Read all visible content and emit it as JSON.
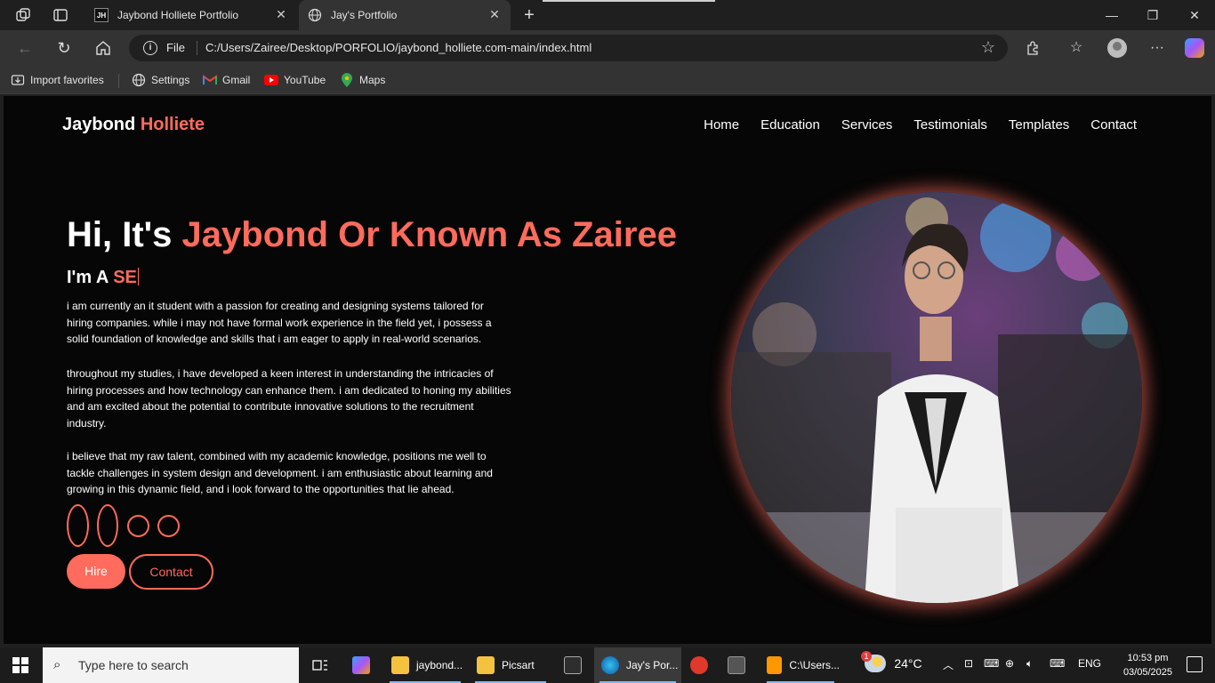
{
  "browser": {
    "tabs": [
      {
        "title": "Jaybond Holliete Portfolio",
        "favicon": "JH",
        "active": false
      },
      {
        "title": "Jay's Portfolio",
        "favicon": "globe-icon",
        "active": true
      }
    ],
    "address": {
      "prefix": "File",
      "url": "C:/Users/Zairee/Desktop/PORFOLIO/jaybond_holliete.com-main/index.html"
    },
    "favorites": [
      {
        "label": "Import favorites",
        "icon": "import-icon"
      },
      {
        "label": "Settings",
        "icon": "globe-icon"
      },
      {
        "label": "Gmail",
        "icon": "gmail-icon"
      },
      {
        "label": "YouTube",
        "icon": "youtube-icon"
      },
      {
        "label": "Maps",
        "icon": "maps-icon"
      }
    ]
  },
  "page": {
    "logo": {
      "first": "Jaybond",
      "last": "Holliete"
    },
    "nav": [
      "Home",
      "Education",
      "Services",
      "Testimonials",
      "Templates",
      "Contact"
    ],
    "hero": {
      "greeting": "Hi, It's",
      "name": "Jaybond Or Known As Zairee",
      "role_prefix": "I'm A",
      "role_typed": "SE",
      "paragraphs": [
        "i am currently an it student with a passion for creating and designing systems tailored for hiring companies. while i may not have formal work experience in the field yet, i possess a solid foundation of knowledge and skills that i am eager to apply in real-world scenarios.",
        "throughout my studies, i have developed a keen interest in understanding the intricacies of hiring processes and how technology can enhance them. i am dedicated to honing my abilities and am excited about the potential to contribute innovative solutions to the recruitment industry.",
        "i believe that my raw talent, combined with my academic knowledge, positions me well to tackle challenges in system design and development. i am enthusiastic about learning and growing in this dynamic field, and i look forward to the opportunities that lie ahead."
      ],
      "buttons": {
        "hire": "Hire",
        "contact": "Contact"
      }
    },
    "colors": {
      "accent": "#ff6b5c",
      "background": "#060606"
    }
  },
  "taskbar": {
    "search_placeholder": "Type here to search",
    "apps": [
      {
        "label": "jaybond..."
      },
      {
        "label": "Picsart"
      },
      {
        "label": "Jay's Por..."
      },
      {
        "label": "C:\\Users..."
      }
    ],
    "weather": "24°C",
    "weather_badge": "1",
    "language": "ENG",
    "time": "10:53 pm",
    "date": "03/05/2025"
  }
}
